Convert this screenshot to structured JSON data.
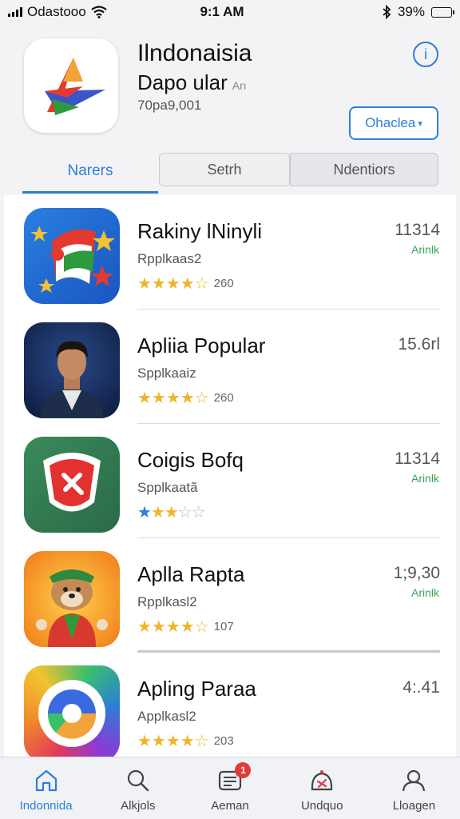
{
  "status_bar": {
    "carrier": "Odastooo",
    "time": "9:1 AM",
    "battery": "39%",
    "battery_level": 0.39
  },
  "app": {
    "title": "Ilndonaisia",
    "subtitle": "Dapo ular",
    "subtitle_tag": "Arı",
    "meta": "70pa9,001",
    "open_label": "Ohaclea",
    "info_label": "i"
  },
  "tabs": [
    {
      "label": "Narers"
    },
    {
      "label": "Setrh"
    },
    {
      "label": "Ndentiors"
    }
  ],
  "apps": [
    {
      "name": "Rakiny lNinyli",
      "category": "Rpplkaas2",
      "rating": 3.5,
      "stars_text": "★★★★☆",
      "rating_count": "260",
      "size": "11314",
      "get": "Arinlk"
    },
    {
      "name": "Apliia Popular",
      "category": "Spplkaaiz",
      "rating": 4,
      "stars_text": "★★★★☆",
      "rating_count": "260",
      "size": "15.6rl",
      "get": ""
    },
    {
      "name": "Coigis Bofq",
      "category": "Spplkaatã",
      "rating": 2.5,
      "stars_text": "★★★☆☆",
      "rating_count": "",
      "size": "11314",
      "get": "Arinlk"
    },
    {
      "name": "Aplla Rapta",
      "category": "Rpplkasl2",
      "rating": 3.5,
      "stars_text": "★★★★☆",
      "rating_count": "107",
      "size": "1;9,30",
      "get": "Arinlk"
    },
    {
      "name": "Apling Paraa",
      "category": "Applkasl2",
      "rating": 3.5,
      "stars_text": "★★★★☆",
      "rating_count": "203",
      "size": "4:.41",
      "get": ""
    }
  ],
  "tab_bar": [
    {
      "label": "Indonnida",
      "icon": "home-icon"
    },
    {
      "label": "Alkjols",
      "icon": "search-icon"
    },
    {
      "label": "Aeman",
      "icon": "updates-icon",
      "badge": "1"
    },
    {
      "label": "Undquo",
      "icon": "games-icon"
    },
    {
      "label": "Lloagen",
      "icon": "profile-icon"
    }
  ],
  "colors": {
    "accent": "#2b7fd6",
    "star": "#f0b429",
    "get_green": "#3aa35a",
    "badge": "#e23a3a"
  }
}
